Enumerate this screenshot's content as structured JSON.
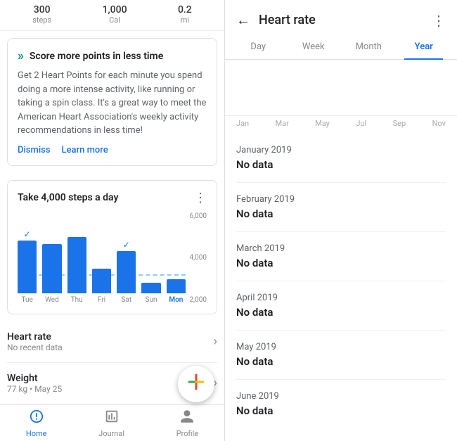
{
  "left": {
    "stats": [
      {
        "value": "300",
        "label": "steps"
      },
      {
        "value": "1,000",
        "label": "Cal"
      },
      {
        "value": "0.2",
        "label": "mi"
      }
    ],
    "score_card": {
      "title": "Score more points in less time",
      "body": "Get 2 Heart Points for each minute you spend doing a more intense activity, like running or taking a spin class. It's a great way to meet the American Heart Association's weekly activity recommendations in less time!",
      "dismiss_label": "Dismiss",
      "learn_label": "Learn more"
    },
    "steps_section": {
      "title": "Take 4,000 steps a day",
      "goal_line": 4000,
      "y_labels": [
        "6,000",
        "4,000",
        "2,000"
      ],
      "bars": [
        {
          "label": "Tue",
          "height": 75,
          "checked": true,
          "active": false
        },
        {
          "label": "Wed",
          "height": 70,
          "checked": false,
          "active": false
        },
        {
          "label": "Thu",
          "height": 80,
          "checked": false,
          "active": false
        },
        {
          "label": "Fri",
          "height": 35,
          "checked": false,
          "active": false
        },
        {
          "label": "Sat",
          "height": 60,
          "checked": true,
          "active": false
        },
        {
          "label": "Sun",
          "height": 15,
          "checked": false,
          "active": false
        },
        {
          "label": "Mon",
          "height": 20,
          "checked": false,
          "active": true
        }
      ]
    },
    "list_items": [
      {
        "title": "Heart rate",
        "sub": "No recent data"
      },
      {
        "title": "Weight",
        "sub": "77 kg • May 25"
      }
    ],
    "fab_label": "+",
    "nav": [
      {
        "label": "Home",
        "icon": "⊙",
        "active": true
      },
      {
        "label": "Journal",
        "icon": "▦",
        "active": false
      },
      {
        "label": "Profile",
        "icon": "⚬",
        "active": false
      }
    ]
  },
  "right": {
    "header": {
      "title": "Heart rate",
      "back_icon": "←",
      "more_icon": "⋮"
    },
    "tabs": [
      {
        "label": "Day",
        "active": false
      },
      {
        "label": "Week",
        "active": false
      },
      {
        "label": "Month",
        "active": false
      },
      {
        "label": "Year",
        "active": true
      }
    ],
    "month_labels": [
      "Jan",
      "Mar",
      "May",
      "Jul",
      "Sep",
      "Nov"
    ],
    "months": [
      {
        "name": "January 2019",
        "value": "No data"
      },
      {
        "name": "February 2019",
        "value": "No data"
      },
      {
        "name": "March 2019",
        "value": "No data"
      },
      {
        "name": "April 2019",
        "value": "No data"
      },
      {
        "name": "May 2019",
        "value": "No data"
      },
      {
        "name": "June 2019",
        "value": "No data"
      }
    ]
  }
}
